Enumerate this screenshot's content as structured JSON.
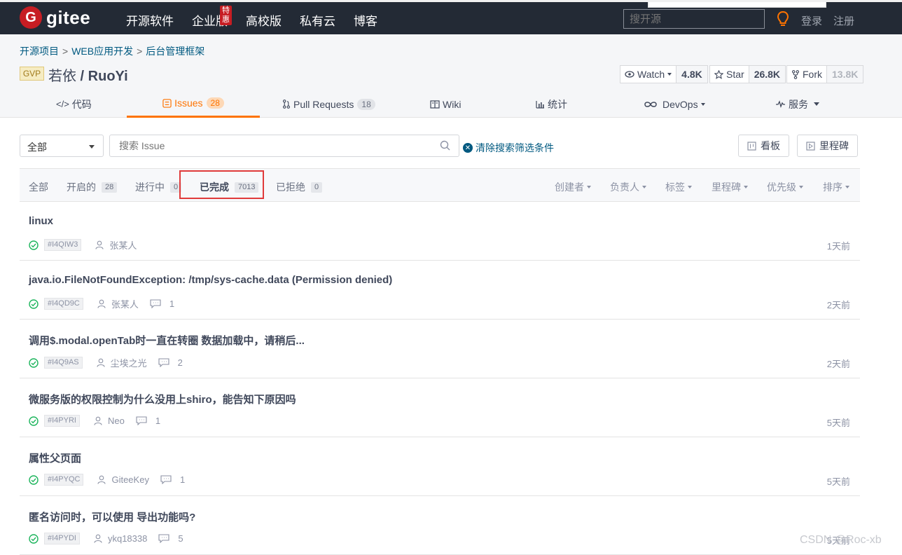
{
  "topnav": {
    "logo_mark": "G",
    "logo_text": "gitee",
    "links": [
      "开源软件",
      "企业版",
      "高校版",
      "私有云",
      "博客"
    ],
    "promo_badge": "特惠",
    "search_placeholder": "搜开源",
    "login": "登录",
    "register": "注册",
    "colors": {
      "bg": "#232a35",
      "brand": "#c71d23",
      "accent": "#fe7300"
    }
  },
  "project": {
    "breadcrumb": [
      "开源项目",
      "WEB应用开发",
      "后台管理框架"
    ],
    "badge": "GVP",
    "owner": "若依",
    "slash": " / ",
    "name": "RuoYi",
    "watch": {
      "label": "Watch",
      "count": "4.8K",
      "icon": "eye-icon"
    },
    "star": {
      "label": "Star",
      "count": "26.8K",
      "icon": "star-icon"
    },
    "fork": {
      "label": "Fork",
      "count": "13.8K",
      "icon": "fork-icon"
    }
  },
  "tabs": [
    {
      "label": "代码",
      "icon": "code-icon"
    },
    {
      "label": "Issues",
      "count": "28",
      "icon": "issues-icon"
    },
    {
      "label": "Pull Requests",
      "count": "18",
      "icon": "pull-request-icon"
    },
    {
      "label": "Wiki",
      "icon": "book-icon"
    },
    {
      "label": "统计",
      "icon": "chart-icon"
    },
    {
      "label": "DevOps",
      "icon": "infinity-icon"
    },
    {
      "label": "服务",
      "icon": "pulse-icon"
    }
  ],
  "filters": {
    "scope_select": "全部",
    "search_placeholder": "搜索 Issue",
    "clear_label": "清除搜索筛选条件",
    "board_label": "看板",
    "milestone_label": "里程碑"
  },
  "status_tabs": [
    {
      "label": "全部"
    },
    {
      "label": "开启的",
      "count": "28"
    },
    {
      "label": "进行中",
      "count": "0"
    },
    {
      "label": "已完成",
      "count": "7013"
    },
    {
      "label": "已拒绝",
      "count": "0"
    }
  ],
  "dropdowns": [
    "创建者",
    "负责人",
    "标签",
    "里程碑",
    "优先级",
    "排序"
  ],
  "issues": [
    {
      "title": "linux",
      "id": "#I4QIW3",
      "author": "张某人",
      "comments": "",
      "time": "1天前"
    },
    {
      "title": "java.io.FileNotFoundException: /tmp/sys-cache.data (Permission denied)",
      "id": "#I4QD9C",
      "author": "张某人",
      "comments": "1",
      "time": "2天前"
    },
    {
      "title": "调用$.modal.openTab时一直在转圈 数据加载中，请稍后...",
      "id": "#I4Q9AS",
      "author": "尘埃之光",
      "comments": "2",
      "time": "2天前"
    },
    {
      "title": "微服务版的权限控制为什么没用上shiro，能告知下原因吗",
      "id": "#I4PYRI",
      "author": "Neo",
      "comments": "1",
      "time": "5天前"
    },
    {
      "title": "属性父页面",
      "id": "#I4PYQC",
      "author": "GiteeKey",
      "comments": "1",
      "time": "5天前"
    },
    {
      "title": "匿名访问时，可以使用 导出功能吗?",
      "id": "#I4PYDI",
      "author": "ykq18338",
      "comments": "5",
      "time": "5天前"
    }
  ],
  "watermark": "CSDN @Roc-xb"
}
